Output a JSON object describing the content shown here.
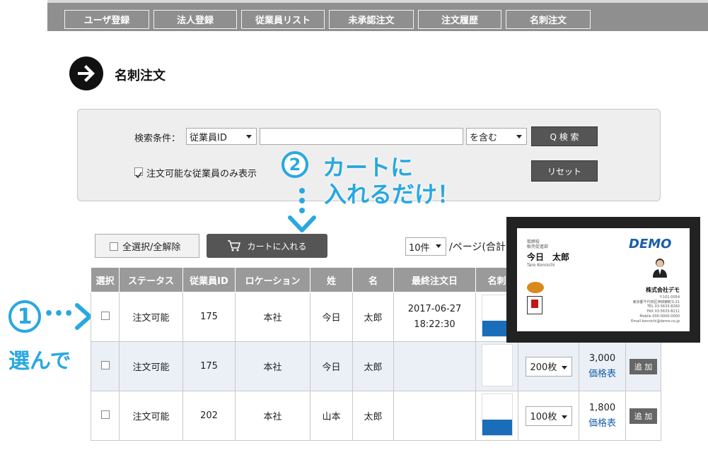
{
  "nav": {
    "tabs": [
      "ユーザ登録",
      "法人登録",
      "従業員リスト",
      "未承認注文",
      "注文履歴",
      "名刺注文"
    ]
  },
  "page": {
    "title": "名刺注文"
  },
  "search": {
    "label": "検索条件：",
    "field_select": "従業員ID",
    "query_value": "",
    "match_select": "を含む",
    "search_button": "Q 検 索",
    "reset_button": "リセット",
    "filter_label": "注文可能な従業員のみ表示",
    "filter_checked": true
  },
  "callouts": {
    "step2_num": "2",
    "step2_line1": "カートに",
    "step2_line2": "入れるだけ！",
    "step1_num": "1",
    "step1_dots": "•••",
    "step1_text": "選んで"
  },
  "toolbar": {
    "select_all": "全選択/全解除",
    "cart_button": "カートに入れる",
    "per_page_value": "10件",
    "per_page_suffix": "/ページ(合計"
  },
  "table": {
    "headers": [
      "選択",
      "ステータス",
      "従業員ID",
      "ロケーション",
      "姓",
      "名",
      "最終注文日",
      "名刺"
    ],
    "rows": [
      {
        "status": "注文可能",
        "id": "175",
        "location": "本社",
        "last": "今日",
        "first": "太郎",
        "date": "2017-06-27",
        "time": "18:22:30",
        "qty": "",
        "price": "",
        "price_link": "",
        "add": ""
      },
      {
        "status": "注文可能",
        "id": "175",
        "location": "本社",
        "last": "今日",
        "first": "太郎",
        "date": "",
        "time": "",
        "qty": "200枚",
        "price": "3,000",
        "price_link": "価格表",
        "add": "追 加"
      },
      {
        "status": "注文可能",
        "id": "202",
        "location": "本社",
        "last": "山本",
        "first": "太郎",
        "date": "",
        "time": "",
        "qty": "100枚",
        "price": "1,800",
        "price_link": "価格表",
        "add": "追 加"
      }
    ]
  },
  "card": {
    "title_line1": "取締役",
    "title_line2": "販売促進部",
    "name": "今日　太郎",
    "romaji": "Taro Konnichi",
    "brand": "DEMO",
    "company": "株式会社デモ",
    "postal": "〒101-0054",
    "address": "東京都千代田区神田錦町3-21",
    "tel": "TEL 03-5633-8260",
    "fax": "FAX 03-5633-8211",
    "mobile": "Mobile 000-0000-0000",
    "email": "Email konnichi@demo.co.jp"
  }
}
